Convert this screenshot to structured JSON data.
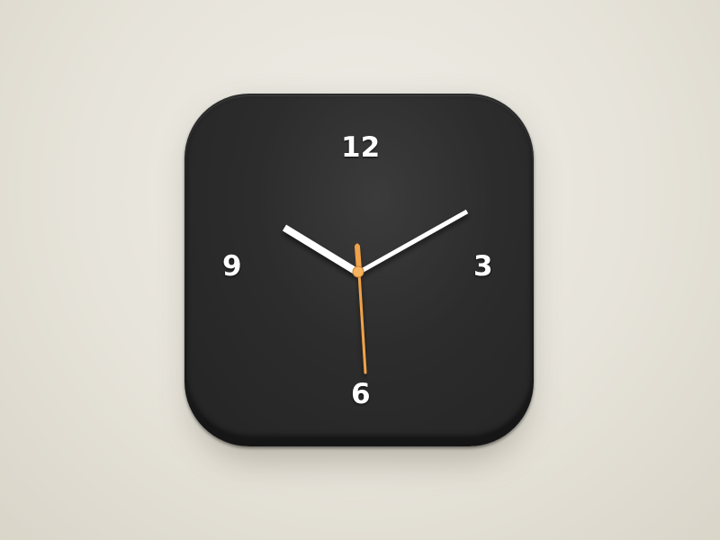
{
  "clock": {
    "numerals": {
      "twelve": "12",
      "three": "3",
      "six": "6",
      "nine": "9"
    },
    "colors": {
      "face": "#2b2b2b",
      "hands": "#ffffff",
      "second_hand": "#f0a24a",
      "numerals": "#ffffff",
      "background": "#e6e3da"
    },
    "icons": [
      "clock-icon",
      "hour-hand",
      "minute-hand",
      "second-hand"
    ]
  }
}
